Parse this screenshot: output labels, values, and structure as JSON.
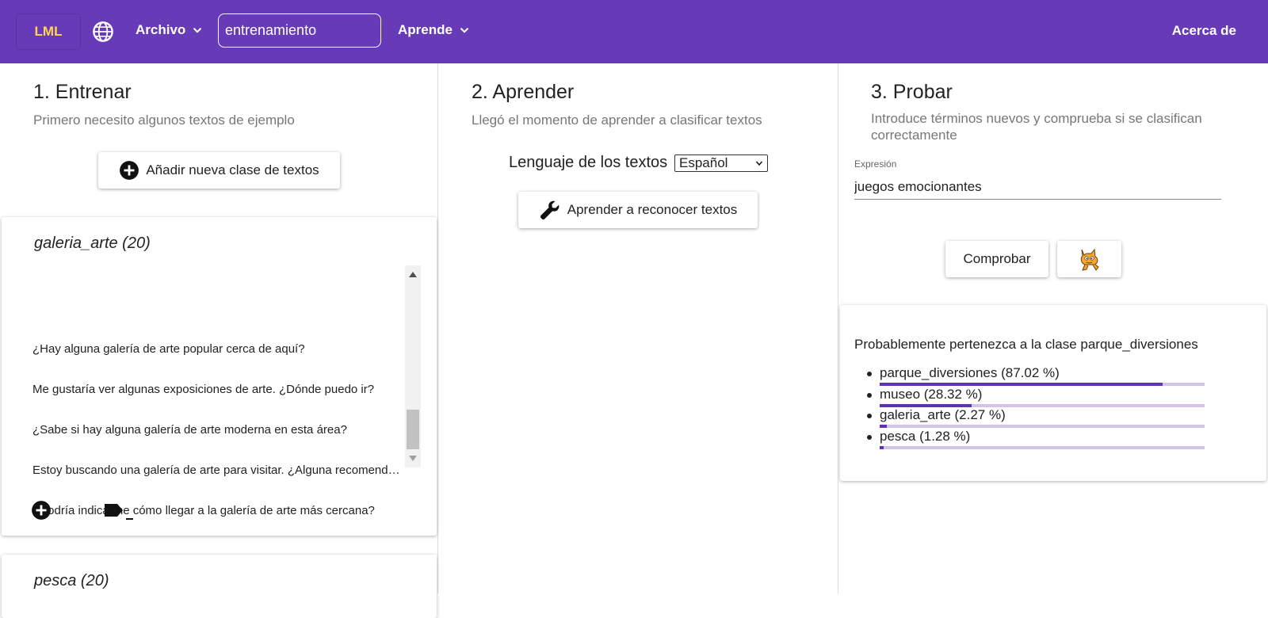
{
  "header": {
    "logo": "LML",
    "menu_archivo": "Archivo",
    "search_value": "entrenamiento",
    "menu_aprende": "Aprende",
    "about": "Acerca de"
  },
  "train": {
    "title": "1. Entrenar",
    "subtitle": "Primero necesito algunos textos de ejemplo",
    "add_class_label": "Añadir nueva clase de textos",
    "cards": [
      {
        "title": "galeria_arte (20)",
        "items": [
          "¿Hay alguna galería de arte popular cerca de aquí?",
          "Me gustaría ver algunas exposiciones de arte. ¿Dónde puedo ir?",
          "¿Sabe si hay alguna galería de arte moderna en esta área?",
          "Estoy buscando una galería de arte para visitar. ¿Alguna recomendación?",
          "¿Podría indicarme cómo llegar a la galería de arte más cercana?"
        ]
      },
      {
        "title": "pesca (20)"
      }
    ]
  },
  "learn": {
    "title": "2. Aprender",
    "subtitle": "Llegó el momento de aprender a clasificar textos",
    "language_label": "Lenguaje de los textos",
    "language_value": "Español",
    "learn_button": "Aprender a reconocer textos"
  },
  "test": {
    "title": "3. Probar",
    "subtitle": "Introduce términos nuevos y comprueba si se clasifican correctamente",
    "field_label": "Expresión",
    "field_value": "juegos emocionantes",
    "check_button": "Comprobar",
    "result_heading": "Probablemente pertenezca a la clase parque_diversiones",
    "results": [
      {
        "label": "parque_diversiones (87.02 %)",
        "pct": 87.02
      },
      {
        "label": "museo (28.32 %)",
        "pct": 28.32
      },
      {
        "label": "galeria_arte (2.27 %)",
        "pct": 2.27
      },
      {
        "label": "pesca (1.28 %)",
        "pct": 1.28
      }
    ]
  },
  "colors": {
    "brand": "#673ab7",
    "logo_text": "#ffd54f",
    "bar_fill": "#5e35b1",
    "bar_track": "#d1c4e9"
  }
}
